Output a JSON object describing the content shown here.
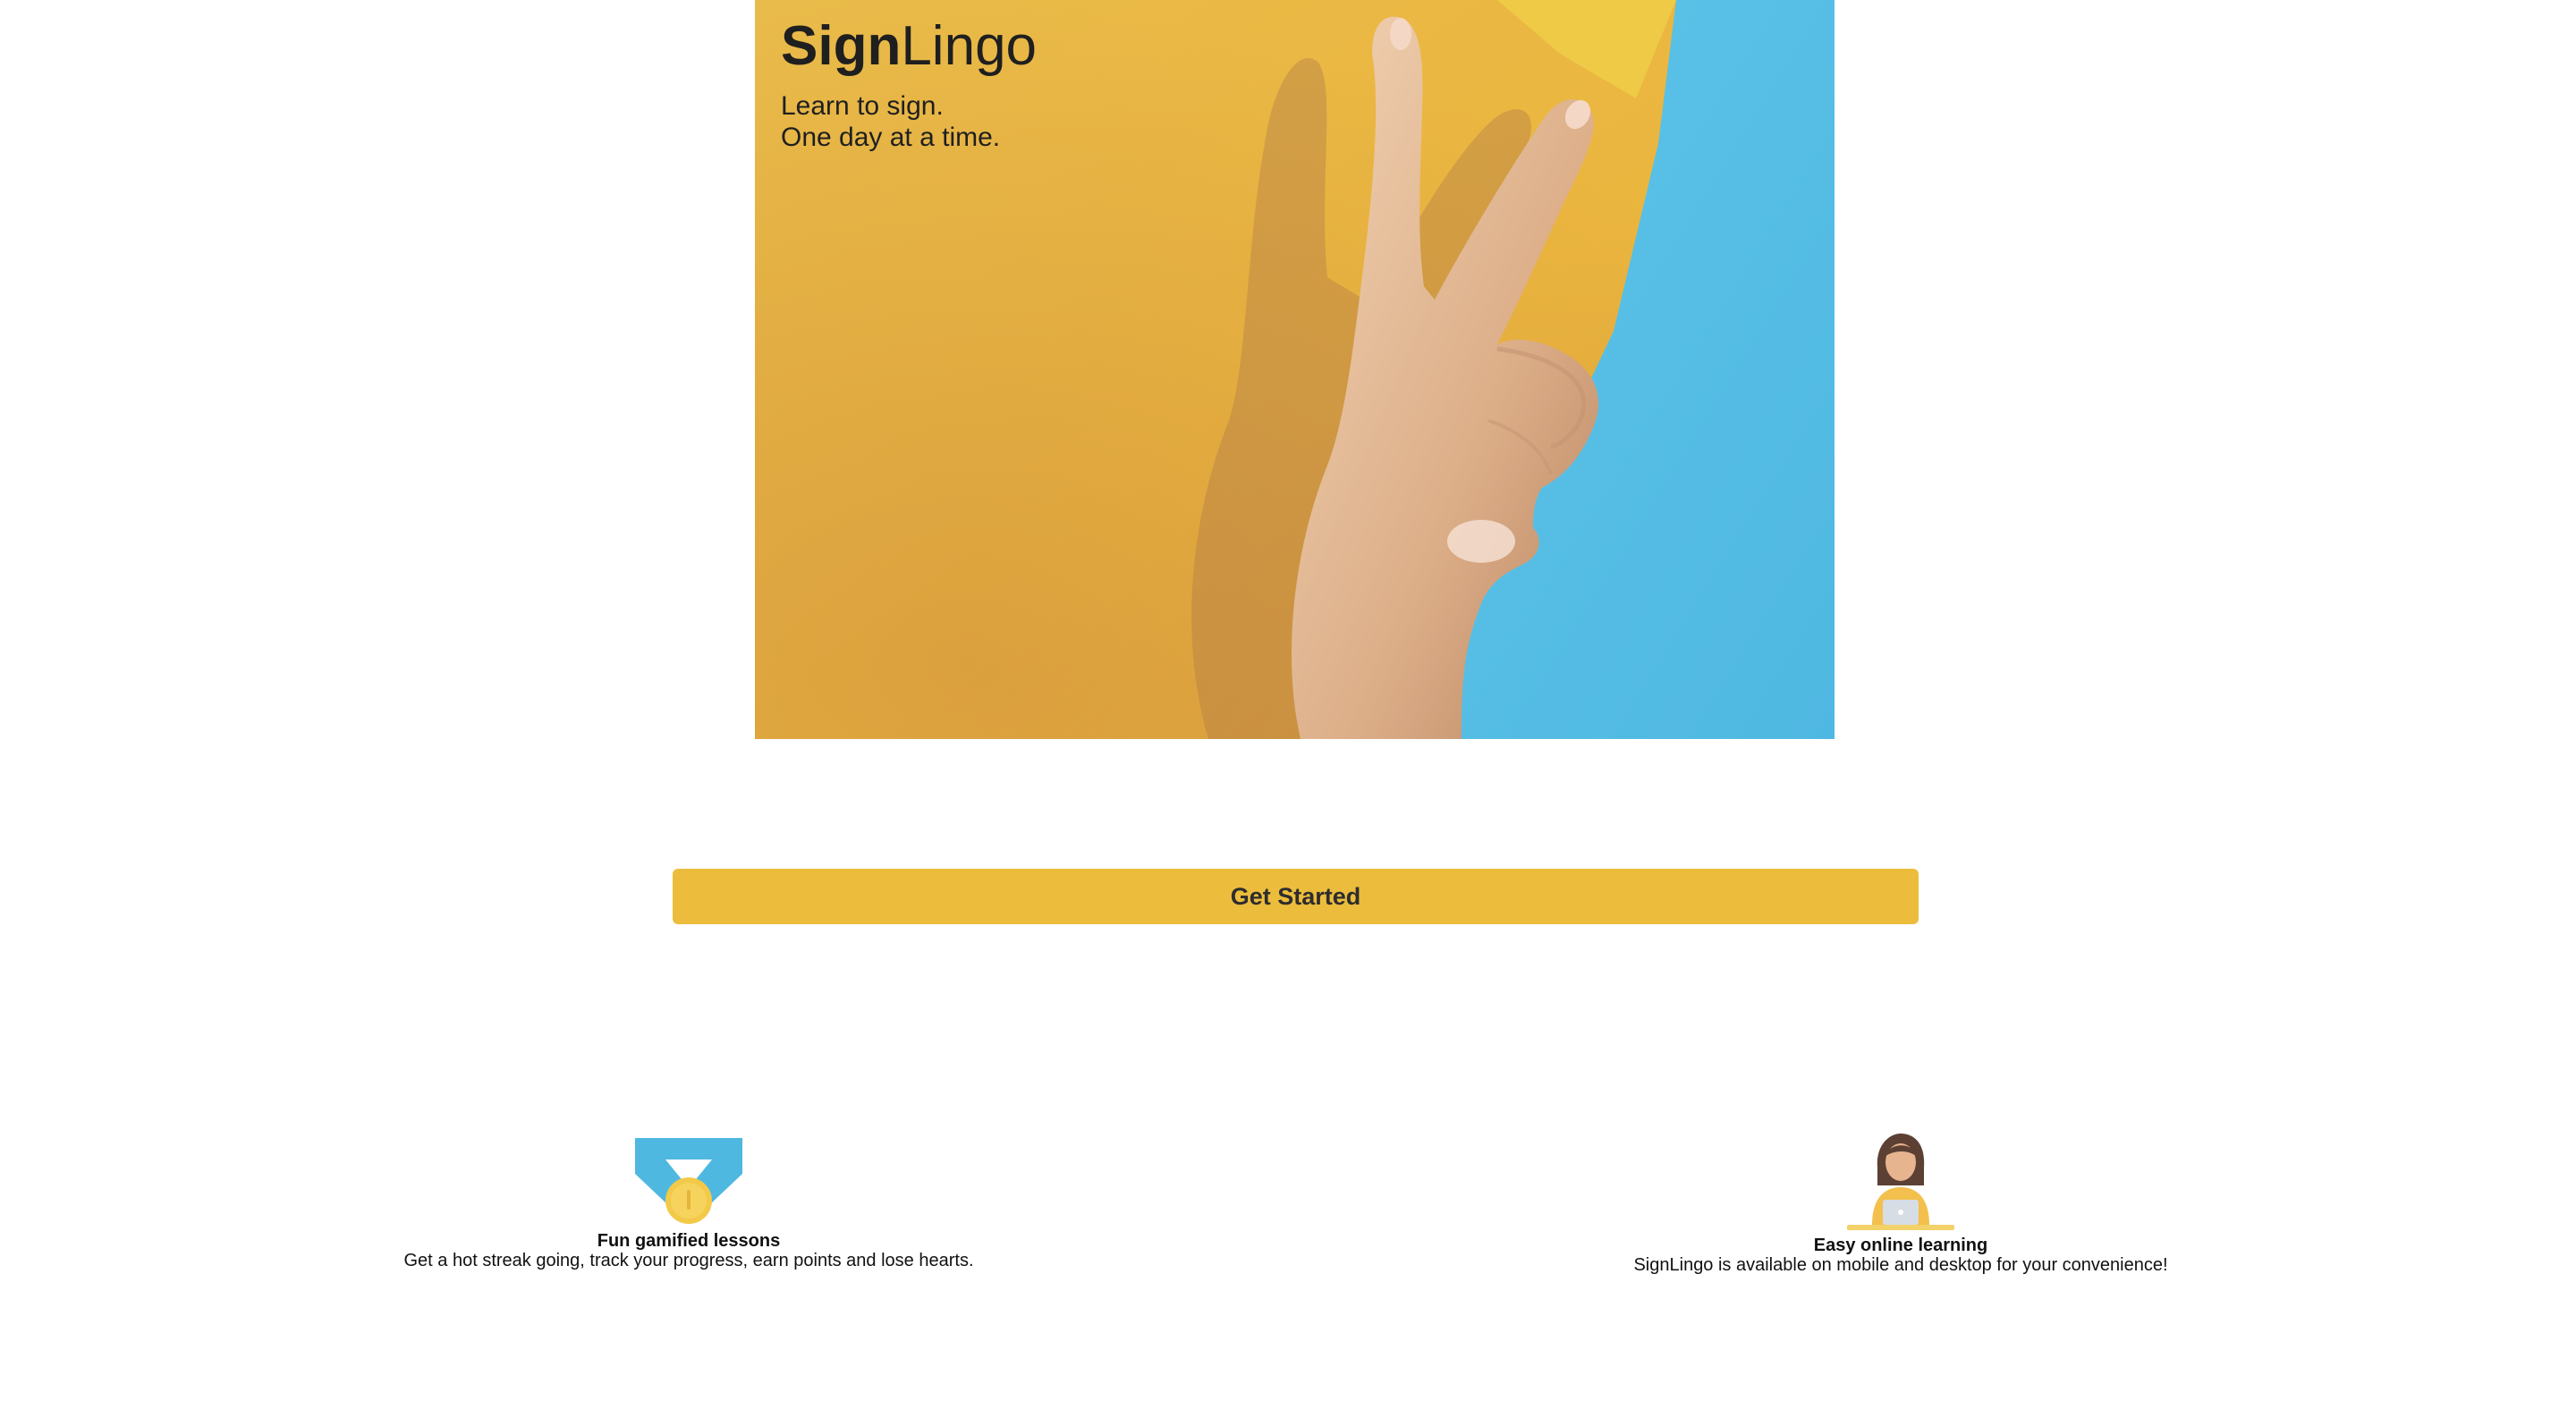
{
  "brand": {
    "name_bold": "Sign",
    "name_light": "Lingo"
  },
  "hero": {
    "tagline_line1": "Learn to sign.",
    "tagline_line2": "One day at a time.",
    "image": "hand-peace-sign-photo"
  },
  "cta": {
    "label": "Get Started"
  },
  "features": [
    {
      "icon": "medal-icon",
      "title": "Fun gamified lessons",
      "description": "Get a hot streak going, track your progress, earn points and lose hearts."
    },
    {
      "icon": "online-learner-icon",
      "title": "Easy online learning",
      "description": "SignLingo is available on mobile and desktop for your convenience!"
    }
  ],
  "colors": {
    "accent": "#ecbd3c",
    "hero_yellow": "#e9b845",
    "hero_blue": "#55bde3",
    "text": "#1f1f1f"
  }
}
